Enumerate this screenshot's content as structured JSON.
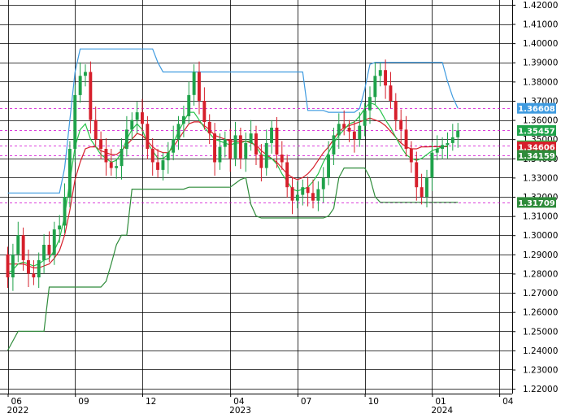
{
  "chart_data": {
    "type": "candlestick",
    "background": "#ffffff",
    "grid": true,
    "colors": {
      "grid": "#000000",
      "bull": "#1fa24a",
      "bear": "#d61f2b",
      "outer_upper": "#3f9be0",
      "outer_lower": "#2e8b3a",
      "inner_band": "#6aaed8",
      "fast_ma": "#27c34a",
      "slow_ma": "#d61f2b",
      "dashed_level": "#d000d0",
      "axis_text": "#000000"
    },
    "y_ticks": [
      "1.42000",
      "1.41000",
      "1.40000",
      "1.39000",
      "1.38000",
      "1.37000",
      "1.36000",
      "1.35000",
      "1.34000",
      "1.33000",
      "1.32000",
      "1.31000",
      "1.30000",
      "1.29000",
      "1.28000",
      "1.27000",
      "1.26000",
      "1.25000",
      "1.24000",
      "1.23000",
      "1.22000"
    ],
    "ylim": [
      1.2175,
      1.4225
    ],
    "x_ticks": [
      {
        "label": "06",
        "sub": "2022",
        "i": 0
      },
      {
        "label": "09",
        "sub": "",
        "i": 13
      },
      {
        "label": "12",
        "sub": "",
        "i": 26
      },
      {
        "label": "04",
        "sub": "2023",
        "i": 43
      },
      {
        "label": "07",
        "sub": "",
        "i": 56
      },
      {
        "label": "10",
        "sub": "",
        "i": 69
      },
      {
        "label": "01",
        "sub": "2024",
        "i": 82
      },
      {
        "label": "04",
        "sub": "",
        "i": 95
      }
    ],
    "x_domain": [
      -1.5,
      97.5
    ],
    "level_badges": [
      {
        "value": 1.36608,
        "text": "1.36608",
        "color": "#3f9be0",
        "dashed": true
      },
      {
        "value": 1.35457,
        "text": "1.35457",
        "color": "#1fa24a",
        "dashed": true
      },
      {
        "value": 1.34661,
        "text": "1.34661",
        "color": "#27c34a",
        "dashed": true
      },
      {
        "value": 1.34606,
        "text": "1.34606",
        "color": "#d61f2b",
        "dashed": false
      },
      {
        "value": 1.34159,
        "text": "1.34159",
        "color": "#2e8b3a",
        "dashed": true
      },
      {
        "value": 1.31709,
        "text": "1.31709",
        "color": "#2e8b3a",
        "dashed": true
      }
    ],
    "close": [
      1.278,
      1.29,
      1.3,
      1.287,
      1.28,
      1.278,
      1.287,
      1.295,
      1.29,
      1.303,
      1.305,
      1.32,
      1.345,
      1.373,
      1.383,
      1.385,
      1.36,
      1.35,
      1.345,
      1.338,
      1.335,
      1.336,
      1.345,
      1.355,
      1.36,
      1.364,
      1.358,
      1.345,
      1.338,
      1.334,
      1.339,
      1.343,
      1.35,
      1.358,
      1.362,
      1.373,
      1.385,
      1.37,
      1.359,
      1.353,
      1.338,
      1.346,
      1.35,
      1.34,
      1.352,
      1.34,
      1.348,
      1.353,
      1.342,
      1.335,
      1.348,
      1.356,
      1.342,
      1.338,
      1.325,
      1.318,
      1.321,
      1.325,
      1.322,
      1.318,
      1.324,
      1.33,
      1.342,
      1.352,
      1.358,
      1.356,
      1.354,
      1.35,
      1.357,
      1.365,
      1.372,
      1.383,
      1.386,
      1.378,
      1.37,
      1.36,
      1.355,
      1.345,
      1.338,
      1.325,
      1.32,
      1.33,
      1.343,
      1.345,
      1.347,
      1.348,
      1.351,
      1.3545
    ],
    "open": [
      1.29,
      1.278,
      1.29,
      1.3,
      1.287,
      1.28,
      1.278,
      1.287,
      1.295,
      1.29,
      1.303,
      1.305,
      1.32,
      1.345,
      1.373,
      1.383,
      1.385,
      1.36,
      1.35,
      1.345,
      1.338,
      1.335,
      1.336,
      1.345,
      1.355,
      1.36,
      1.364,
      1.358,
      1.345,
      1.338,
      1.334,
      1.339,
      1.343,
      1.35,
      1.358,
      1.362,
      1.373,
      1.385,
      1.37,
      1.359,
      1.353,
      1.338,
      1.346,
      1.35,
      1.34,
      1.352,
      1.34,
      1.348,
      1.353,
      1.342,
      1.335,
      1.348,
      1.356,
      1.342,
      1.338,
      1.325,
      1.318,
      1.321,
      1.325,
      1.322,
      1.318,
      1.324,
      1.33,
      1.342,
      1.352,
      1.358,
      1.356,
      1.354,
      1.35,
      1.357,
      1.365,
      1.372,
      1.383,
      1.386,
      1.378,
      1.37,
      1.36,
      1.355,
      1.345,
      1.338,
      1.325,
      1.32,
      1.33,
      1.343,
      1.345,
      1.347,
      1.348,
      1.351
    ],
    "outer_upper": [
      1.322,
      1.322,
      1.322,
      1.322,
      1.322,
      1.322,
      1.322,
      1.322,
      1.322,
      1.322,
      1.322,
      1.335,
      1.36,
      1.385,
      1.397,
      1.397,
      1.397,
      1.397,
      1.397,
      1.397,
      1.397,
      1.397,
      1.397,
      1.397,
      1.397,
      1.397,
      1.397,
      1.397,
      1.397,
      1.39,
      1.385,
      1.385,
      1.385,
      1.385,
      1.385,
      1.385,
      1.385,
      1.385,
      1.385,
      1.385,
      1.385,
      1.385,
      1.385,
      1.385,
      1.385,
      1.385,
      1.385,
      1.385,
      1.385,
      1.385,
      1.385,
      1.385,
      1.385,
      1.385,
      1.385,
      1.385,
      1.385,
      1.385,
      1.365,
      1.365,
      1.365,
      1.365,
      1.364,
      1.364,
      1.364,
      1.364,
      1.364,
      1.364,
      1.366,
      1.376,
      1.389,
      1.39,
      1.39,
      1.39,
      1.39,
      1.39,
      1.39,
      1.39,
      1.39,
      1.39,
      1.39,
      1.39,
      1.39,
      1.39,
      1.39,
      1.38,
      1.372,
      1.3661
    ],
    "outer_lower": [
      1.24,
      1.245,
      1.25,
      1.25,
      1.25,
      1.25,
      1.25,
      1.25,
      1.273,
      1.273,
      1.273,
      1.273,
      1.273,
      1.273,
      1.273,
      1.273,
      1.273,
      1.273,
      1.273,
      1.276,
      1.285,
      1.295,
      1.3,
      1.3,
      1.324,
      1.324,
      1.324,
      1.324,
      1.324,
      1.324,
      1.324,
      1.324,
      1.324,
      1.324,
      1.324,
      1.325,
      1.325,
      1.325,
      1.325,
      1.325,
      1.325,
      1.325,
      1.325,
      1.325,
      1.327,
      1.329,
      1.33,
      1.316,
      1.31,
      1.309,
      1.309,
      1.309,
      1.309,
      1.309,
      1.309,
      1.309,
      1.309,
      1.309,
      1.309,
      1.309,
      1.309,
      1.309,
      1.31,
      1.314,
      1.33,
      1.335,
      1.335,
      1.335,
      1.335,
      1.335,
      1.33,
      1.32,
      1.3171,
      1.3171,
      1.3171,
      1.3171,
      1.3171,
      1.3171,
      1.3171,
      1.3171,
      1.3171,
      1.3171,
      1.3171,
      1.3171,
      1.3171,
      1.3171,
      1.3171,
      1.3171
    ],
    "fast_ma": [
      1.28,
      1.282,
      1.285,
      1.286,
      1.285,
      1.284,
      1.285,
      1.287,
      1.288,
      1.292,
      1.298,
      1.31,
      1.328,
      1.346,
      1.355,
      1.358,
      1.35,
      1.346,
      1.342,
      1.34,
      1.338,
      1.339,
      1.343,
      1.35,
      1.355,
      1.358,
      1.355,
      1.348,
      1.344,
      1.34,
      1.34,
      1.342,
      1.348,
      1.354,
      1.359,
      1.364,
      1.364,
      1.36,
      1.356,
      1.353,
      1.35,
      1.349,
      1.348,
      1.347,
      1.348,
      1.348,
      1.349,
      1.349,
      1.346,
      1.342,
      1.341,
      1.34,
      1.337,
      1.332,
      1.328,
      1.324,
      1.323,
      1.324,
      1.325,
      1.328,
      1.332,
      1.338,
      1.343,
      1.348,
      1.352,
      1.355,
      1.358,
      1.359,
      1.362,
      1.366,
      1.369,
      1.368,
      1.365,
      1.36,
      1.356,
      1.351,
      1.346,
      1.342,
      1.34,
      1.339,
      1.34,
      1.342,
      1.344,
      1.345,
      1.346,
      1.3466
    ],
    "slow_ma": [
      1.285,
      1.285,
      1.285,
      1.285,
      1.284,
      1.283,
      1.283,
      1.284,
      1.285,
      1.288,
      1.292,
      1.3,
      1.313,
      1.329,
      1.338,
      1.345,
      1.346,
      1.346,
      1.344,
      1.343,
      1.342,
      1.342,
      1.344,
      1.347,
      1.35,
      1.353,
      1.352,
      1.349,
      1.346,
      1.344,
      1.343,
      1.343,
      1.346,
      1.35,
      1.354,
      1.358,
      1.359,
      1.359,
      1.357,
      1.355,
      1.352,
      1.351,
      1.35,
      1.349,
      1.349,
      1.349,
      1.349,
      1.348,
      1.347,
      1.344,
      1.342,
      1.34,
      1.338,
      1.335,
      1.332,
      1.33,
      1.329,
      1.33,
      1.332,
      1.335,
      1.339,
      1.343,
      1.346,
      1.35,
      1.354,
      1.356,
      1.357,
      1.358,
      1.359,
      1.36,
      1.361,
      1.36,
      1.359,
      1.357,
      1.354,
      1.351,
      1.348,
      1.346,
      1.345,
      1.345,
      1.346,
      1.346,
      1.3461,
      1.3461,
      1.3461,
      1.3461
    ]
  }
}
